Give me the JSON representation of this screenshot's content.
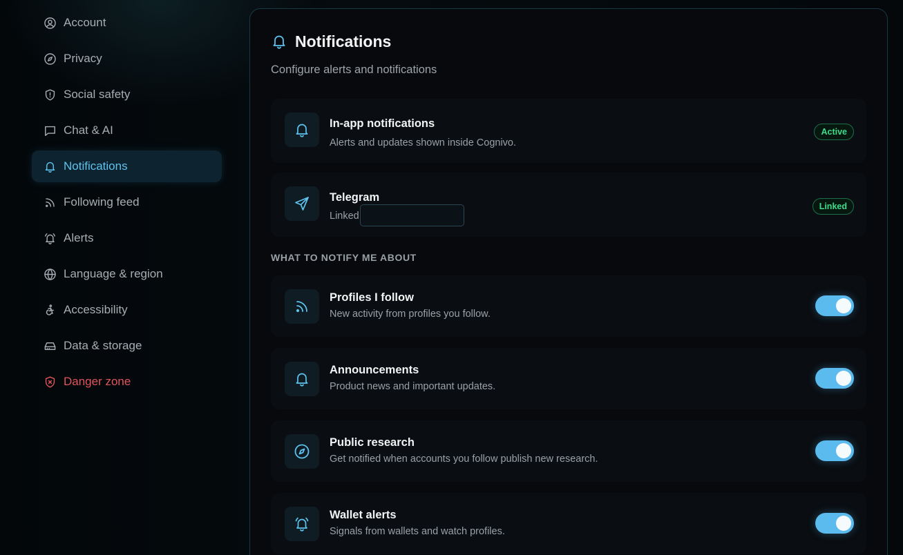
{
  "sidebar": {
    "items": [
      {
        "label": "Account",
        "icon": "user-circle-icon"
      },
      {
        "label": "Privacy",
        "icon": "compass-icon"
      },
      {
        "label": "Social safety",
        "icon": "shield-icon"
      },
      {
        "label": "Chat & AI",
        "icon": "chat-bubble-icon"
      },
      {
        "label": "Notifications",
        "icon": "bell-icon",
        "active": true
      },
      {
        "label": "Following feed",
        "icon": "rss-icon"
      },
      {
        "label": "Alerts",
        "icon": "alarm-bell-icon"
      },
      {
        "label": "Language & region",
        "icon": "globe-icon"
      },
      {
        "label": "Accessibility",
        "icon": "accessibility-icon"
      },
      {
        "label": "Data & storage",
        "icon": "hard-drive-icon"
      },
      {
        "label": "Danger zone",
        "icon": "shield-x-icon",
        "danger": true
      }
    ]
  },
  "panel": {
    "title": "Notifications",
    "subtitle": "Configure alerts and notifications",
    "channels": [
      {
        "title": "In-app notifications",
        "desc": "Alerts and updates shown inside Cognivo.",
        "badge": "Active",
        "icon": "bell-icon"
      },
      {
        "title": "Telegram",
        "desc": "Linked",
        "badge": "Linked",
        "icon": "send-icon",
        "input_value": ""
      }
    ],
    "section_label": "WHAT TO NOTIFY ME ABOUT",
    "topics": [
      {
        "title": "Profiles I follow",
        "desc": "New activity from profiles you follow.",
        "icon": "rss-icon",
        "enabled": true
      },
      {
        "title": "Announcements",
        "desc": "Product news and important updates.",
        "icon": "bell-icon",
        "enabled": true
      },
      {
        "title": "Public research",
        "desc": "Get notified when accounts you follow publish new research.",
        "icon": "compass-icon",
        "enabled": true
      },
      {
        "title": "Wallet alerts",
        "desc": "Signals from wallets and watch profiles.",
        "icon": "alarm-bell-icon",
        "enabled": true
      }
    ]
  },
  "colors": {
    "accent": "#5ec3ee",
    "danger": "#e0545c",
    "success": "#3ddc8a"
  }
}
